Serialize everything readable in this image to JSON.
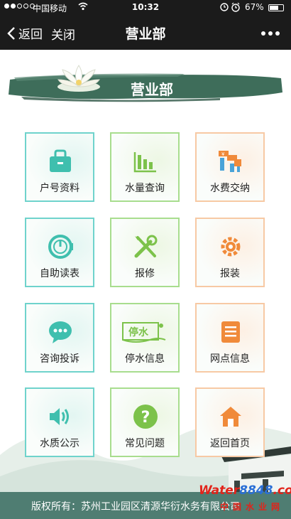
{
  "status_bar": {
    "carrier": "中国移动",
    "time": "10:32",
    "battery": "67%",
    "battery_level": 0.67
  },
  "nav": {
    "back_label": "返回",
    "close_label": "关闭",
    "title": "营业部",
    "more_icon": "more-icon"
  },
  "banner": {
    "title": "营业部"
  },
  "tiles": [
    {
      "label": "户号资料",
      "icon": "bag-icon",
      "color": "#3fbfae"
    },
    {
      "label": "水量查询",
      "icon": "bar-chart-icon",
      "color": "#7cc24a"
    },
    {
      "label": "水费交纳",
      "icon": "water-fee-icon",
      "color": "#f08a3a"
    },
    {
      "label": "自助读表",
      "icon": "meter-icon",
      "color": "#3fbfae"
    },
    {
      "label": "报修",
      "icon": "tools-icon",
      "color": "#7cc24a"
    },
    {
      "label": "报装",
      "icon": "gear-icon",
      "color": "#f08a3a"
    },
    {
      "label": "咨询投诉",
      "icon": "chat-icon",
      "color": "#3fbfae"
    },
    {
      "label": "停水信息",
      "icon": "water-stop-icon",
      "color": "#7cc24a",
      "badge": "停水"
    },
    {
      "label": "网点信息",
      "icon": "document-icon",
      "color": "#f08a3a"
    },
    {
      "label": "水质公示",
      "icon": "speaker-icon",
      "color": "#3fbfae"
    },
    {
      "label": "常见问题",
      "icon": "question-icon",
      "color": "#7cc24a"
    },
    {
      "label": "返回首页",
      "icon": "home-icon",
      "color": "#f08a3a"
    }
  ],
  "footer": {
    "text": "版权所有：苏州工业园区清源华衍水务有限公司"
  },
  "watermark": {
    "part1": "Water",
    "part2": "8848",
    "part3": ".com",
    "sub": "中国水业网"
  }
}
